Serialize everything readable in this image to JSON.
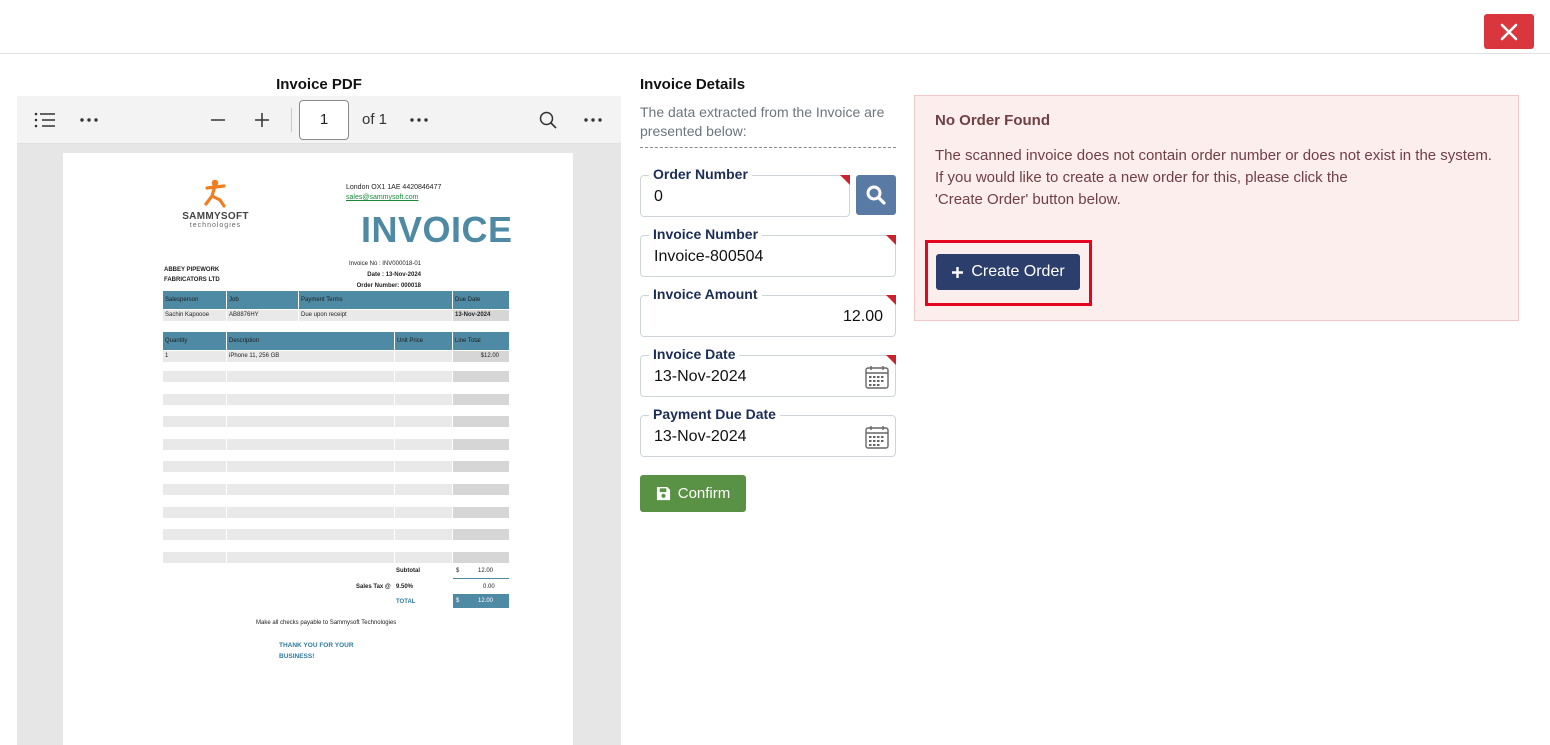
{
  "header": {
    "close_icon": "close-icon"
  },
  "pdf_panel": {
    "title": "Invoice PDF",
    "toolbar": {
      "page_value": "1",
      "page_of": "of 1"
    },
    "invoice": {
      "company_logo_text": "SAMMYSOFT",
      "company_logo_sub": "technologies",
      "address_line": "London OX1 1AE 4420846477",
      "email": "sales@sammysoft.com",
      "heading": "INVOICE",
      "invoice_no_line": "Invoice No : INV000018-01",
      "date_line": "Date : 13-Nov-2024",
      "order_number_line": "Order Number: 000018",
      "customer_line1": "ABBEY PIPEWORK",
      "customer_line2": "FABRICATORS LTD",
      "job_headers": [
        "Salesperson",
        "Job",
        "Payment Terms",
        "Due Date"
      ],
      "job_values": [
        "Sachin Kapoooe",
        "AB8876HY",
        "Due upon receipt",
        "13-Nov-2024"
      ],
      "item_headers": [
        "Quantity",
        "Description",
        "Unit Price",
        "Line Total"
      ],
      "item_row": [
        "1",
        "iPhone 11, 256 GB",
        "",
        "$12.00"
      ],
      "subtotal_label": "Subtotal",
      "subtotal_currency": "$",
      "subtotal_value": "12.00",
      "tax_label": "Sales Tax @",
      "tax_rate": "9.50%",
      "tax_value": "0.00",
      "total_label": "TOTAL",
      "total_currency": "$",
      "total_value": "12.00",
      "checks_note": "Make all checks payable to Sammysoft Technologies",
      "thanks_line1": "THANK YOU FOR YOUR",
      "thanks_line2": "BUSINESS!"
    }
  },
  "details": {
    "title": "Invoice Details",
    "subtitle": "The data extracted from the Invoice are presented below:",
    "fields": {
      "order_number": {
        "label": "Order Number",
        "value": "0"
      },
      "invoice_number": {
        "label": "Invoice Number",
        "value": "Invoice-800504"
      },
      "invoice_amount": {
        "label": "Invoice Amount",
        "value": "12.00"
      },
      "invoice_date": {
        "label": "Invoice Date",
        "value": "13-Nov-2024"
      },
      "payment_due_date": {
        "label": "Payment Due Date",
        "value": "13-Nov-2024"
      }
    },
    "confirm_label": "Confirm"
  },
  "alert": {
    "title": "No Order Found",
    "line1": "The scanned invoice does not contain order number or does not exist in the system.",
    "line2": "If you would like to create a new order for this, please click the",
    "line3": "'Create Order' button below.",
    "create_label": "Create Order"
  },
  "colors": {
    "close_red": "#d9363e",
    "create_navy": "#2c3e6b",
    "confirm_green": "#5a9245",
    "invoice_teal": "#4e8aa3",
    "highlight_red": "#e3061e"
  }
}
